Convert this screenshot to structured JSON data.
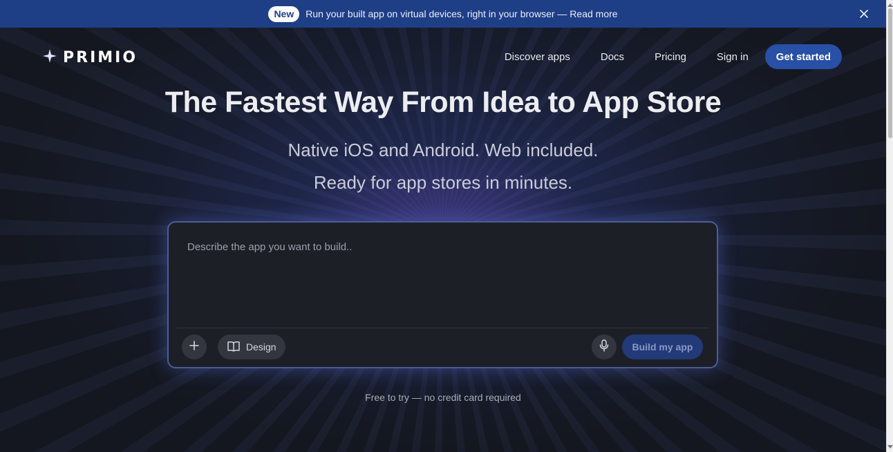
{
  "announcement": {
    "badge": "New",
    "text": "Run your built app on virtual devices, right in your browser — Read more",
    "close_icon": "close-icon",
    "background": "#1e3f86"
  },
  "nav": {
    "logo_text": "PRIMIO",
    "logo_icon": "sparkle-icon",
    "links": [
      "Discover apps",
      "Docs",
      "Pricing",
      "Sign in"
    ],
    "cta": "Get started",
    "cta_color": "#2850a6"
  },
  "hero": {
    "title": "The Fastest Way From Idea to App Store",
    "subtitle_line1": "Native iOS and Android. Web included.",
    "subtitle_line2": "Ready for app stores in minutes."
  },
  "prompt": {
    "placeholder": "Describe the app you want to build..",
    "value": "",
    "add_icon": "plus-icon",
    "design_label": "Design",
    "design_icon": "book-icon",
    "mic_icon": "microphone-icon",
    "build_label": "Build my app"
  },
  "footer_note": "Free to try — no credit card required"
}
